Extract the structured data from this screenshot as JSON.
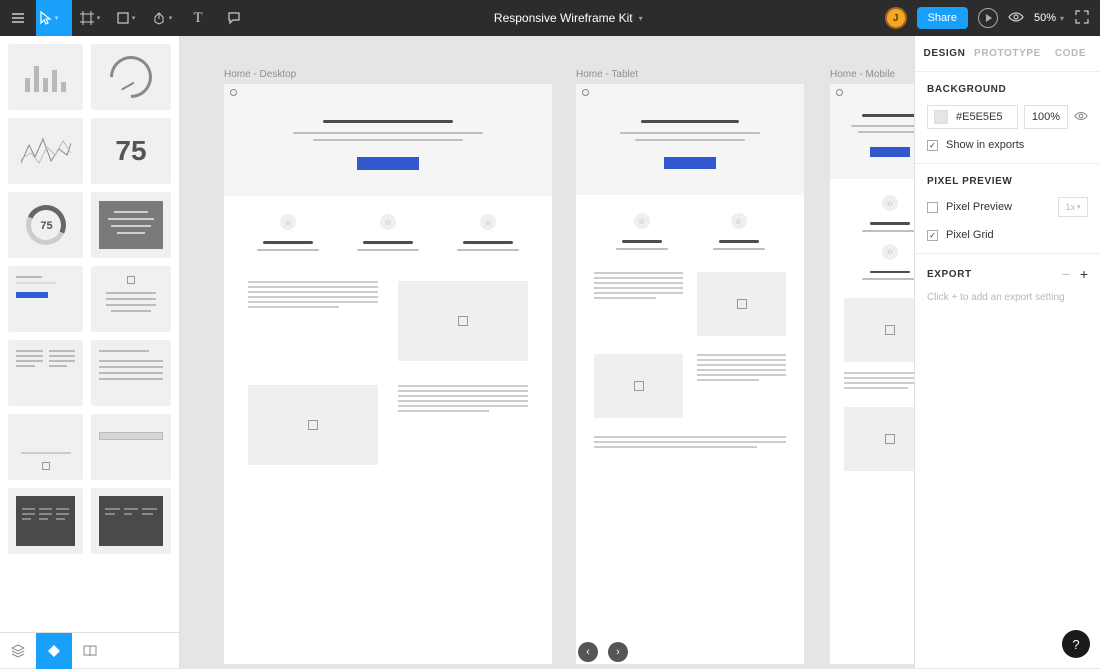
{
  "app": {
    "title": "Responsive Wireframe Kit"
  },
  "toolbar": {
    "share_label": "Share",
    "zoom_label": "50%"
  },
  "avatar": {
    "initial": "J"
  },
  "assets": {
    "big_number": "75",
    "donut_label": "75"
  },
  "frames": {
    "desktop_label": "Home - Desktop",
    "tablet_label": "Home - Tablet",
    "mobile_label": "Home - Mobile"
  },
  "inspector": {
    "tabs": {
      "design": "DESIGN",
      "prototype": "PROTOTYPE",
      "code": "CODE"
    },
    "background": {
      "title": "BACKGROUND",
      "hex": "#E5E5E5",
      "opacity": "100%",
      "show_in_exports": "Show in exports"
    },
    "pixel_preview": {
      "title": "PIXEL PREVIEW",
      "pixel_preview": "Pixel Preview",
      "scale": "1x",
      "pixel_grid": "Pixel Grid"
    },
    "export": {
      "title": "EXPORT",
      "hint": "Click + to add an export setting"
    }
  },
  "help": {
    "label": "?"
  }
}
